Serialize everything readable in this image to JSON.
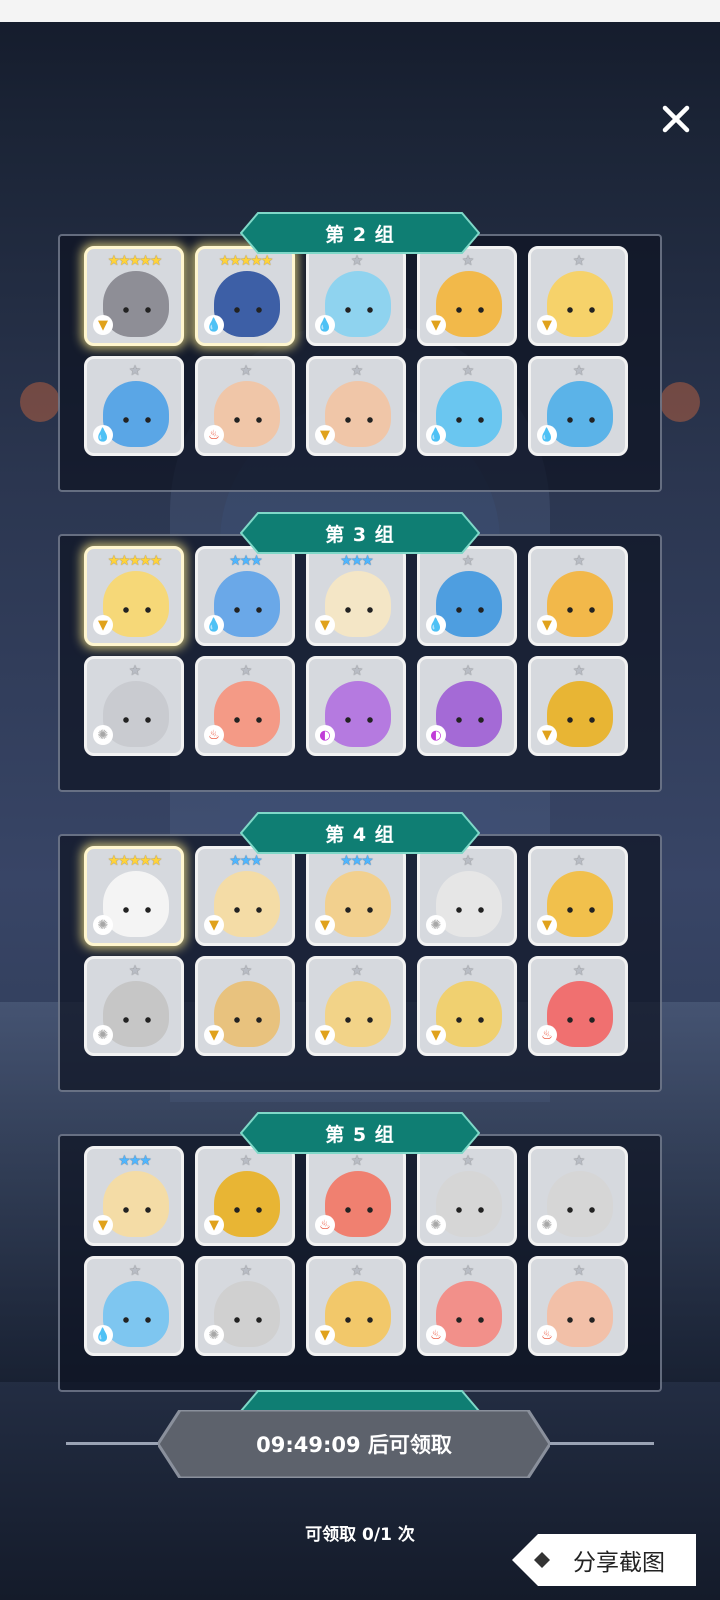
{
  "groups": [
    {
      "label": "",
      "cards": []
    },
    {
      "label": "第 2 组",
      "cards": [
        {
          "stars": "★★★★★",
          "rank": "gold",
          "element": "earth",
          "color": "#8e8e96"
        },
        {
          "stars": "★★★★★",
          "rank": "gold",
          "element": "water",
          "color": "#3d5fa6"
        },
        {
          "stars": "★",
          "rank": "grey",
          "element": "water",
          "color": "#8fd3ef"
        },
        {
          "stars": "★",
          "rank": "grey",
          "element": "earth",
          "color": "#f2b94a"
        },
        {
          "stars": "★",
          "rank": "grey",
          "element": "earth",
          "color": "#f6d26a"
        },
        {
          "stars": "★",
          "rank": "grey",
          "element": "water",
          "color": "#5aa6e6"
        },
        {
          "stars": "★",
          "rank": "grey",
          "element": "fire",
          "color": "#f0c6a8"
        },
        {
          "stars": "★",
          "rank": "grey",
          "element": "earth",
          "color": "#f0c6a8"
        },
        {
          "stars": "★",
          "rank": "grey",
          "element": "water",
          "color": "#6ac6f0"
        },
        {
          "stars": "★",
          "rank": "grey",
          "element": "water",
          "color": "#5bb3e8"
        }
      ]
    },
    {
      "label": "第 3 组",
      "cards": [
        {
          "stars": "★★★★★",
          "rank": "gold",
          "element": "earth",
          "color": "#f6d878"
        },
        {
          "stars": "★★★",
          "rank": "blue",
          "element": "water",
          "color": "#6aa8e8"
        },
        {
          "stars": "★★★",
          "rank": "blue",
          "element": "earth",
          "color": "#f4e6c6"
        },
        {
          "stars": "★",
          "rank": "grey",
          "element": "water",
          "color": "#4e9ee0"
        },
        {
          "stars": "★",
          "rank": "grey",
          "element": "earth",
          "color": "#f2b84a"
        },
        {
          "stars": "★",
          "rank": "grey",
          "element": "light",
          "color": "#c9cbd0"
        },
        {
          "stars": "★",
          "rank": "grey",
          "element": "fire",
          "color": "#f49a86"
        },
        {
          "stars": "★",
          "rank": "grey",
          "element": "dark",
          "color": "#b57ae0"
        },
        {
          "stars": "★",
          "rank": "grey",
          "element": "dark",
          "color": "#a46ad6"
        },
        {
          "stars": "★",
          "rank": "grey",
          "element": "earth",
          "color": "#e8b534"
        }
      ]
    },
    {
      "label": "第 4 组",
      "cards": [
        {
          "stars": "★★★★★",
          "rank": "gold",
          "element": "light",
          "color": "#f4f4f4"
        },
        {
          "stars": "★★★",
          "rank": "blue",
          "element": "earth",
          "color": "#f4dca6"
        },
        {
          "stars": "★★★",
          "rank": "blue",
          "element": "earth",
          "color": "#f2d08e"
        },
        {
          "stars": "★",
          "rank": "grey",
          "element": "light",
          "color": "#e6e6e6"
        },
        {
          "stars": "★",
          "rank": "grey",
          "element": "earth",
          "color": "#f1c04c"
        },
        {
          "stars": "★",
          "rank": "grey",
          "element": "light",
          "color": "#c6c6c6"
        },
        {
          "stars": "★",
          "rank": "grey",
          "element": "earth",
          "color": "#e8c27e"
        },
        {
          "stars": "★",
          "rank": "grey",
          "element": "earth",
          "color": "#f2d388"
        },
        {
          "stars": "★",
          "rank": "grey",
          "element": "earth",
          "color": "#f0d070"
        },
        {
          "stars": "★",
          "rank": "grey",
          "element": "fire",
          "color": "#f07070"
        }
      ]
    },
    {
      "label": "第 5 组",
      "cards": [
        {
          "stars": "★★★",
          "rank": "blue",
          "element": "earth",
          "color": "#f4dca6"
        },
        {
          "stars": "★",
          "rank": "grey",
          "element": "earth",
          "color": "#e8b534"
        },
        {
          "stars": "★",
          "rank": "grey",
          "element": "fire",
          "color": "#f08070"
        },
        {
          "stars": "★",
          "rank": "grey",
          "element": "light",
          "color": "#d6d6d6"
        },
        {
          "stars": "★",
          "rank": "grey",
          "element": "light",
          "color": "#d6d6d6"
        },
        {
          "stars": "★",
          "rank": "grey",
          "element": "water",
          "color": "#7ec6f0"
        },
        {
          "stars": "★",
          "rank": "grey",
          "element": "light",
          "color": "#d0d0d0"
        },
        {
          "stars": "★",
          "rank": "grey",
          "element": "earth",
          "color": "#f2c86a"
        },
        {
          "stars": "★",
          "rank": "grey",
          "element": "fire",
          "color": "#f2908a"
        },
        {
          "stars": "★",
          "rank": "grey",
          "element": "fire",
          "color": "#f2c0a8"
        }
      ]
    }
  ],
  "element_glyphs": {
    "water": "💧",
    "fire": "♨",
    "earth": "▼",
    "light": "✺",
    "dark": "◐"
  },
  "footer": {
    "timer_label": "09:49:09 后可领取",
    "claim_count": "可领取 0/1 次",
    "share_label": "分享截图"
  },
  "colors": {
    "banner": "#0f7e73",
    "banner_edge": "#7fd8c8",
    "timer_bg": "#5d626c"
  }
}
